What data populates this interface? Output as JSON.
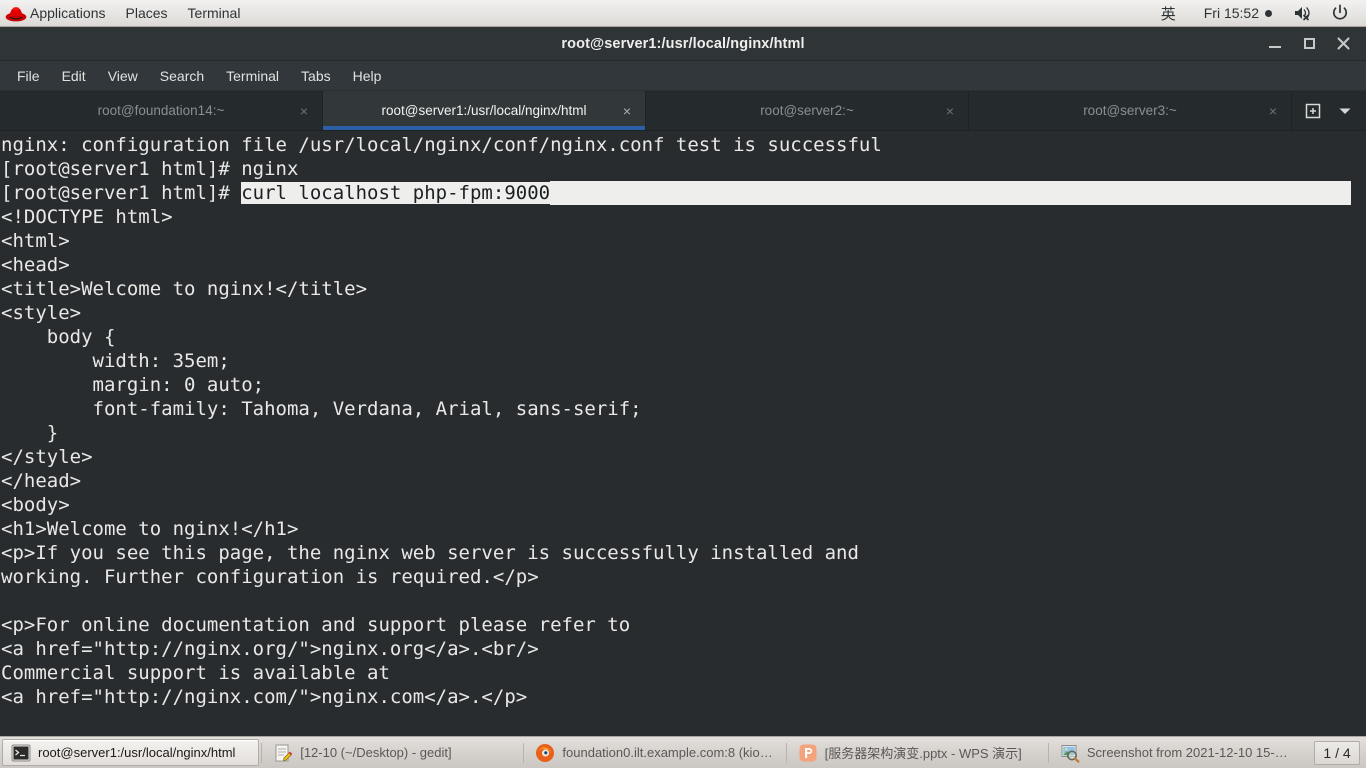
{
  "gnome_panel": {
    "logo_icon": "redhat-logo-icon",
    "menus": [
      "Applications",
      "Places",
      "Terminal"
    ],
    "input_method": "英",
    "clock": "Fri 15:52",
    "clock_dot": "●",
    "volume_icon": "speaker-muted-icon",
    "power_icon": "power-icon"
  },
  "window": {
    "title": "root@server1:/usr/local/nginx/html",
    "minimize_label": "Minimize",
    "maximize_label": "Maximize",
    "close_label": "Close"
  },
  "menubar": {
    "items": [
      "File",
      "Edit",
      "View",
      "Search",
      "Terminal",
      "Tabs",
      "Help"
    ]
  },
  "tabs": {
    "items": [
      {
        "label": "root@foundation14:~",
        "active": false,
        "close": "×"
      },
      {
        "label": "root@server1:/usr/local/nginx/html",
        "active": true,
        "close": "×"
      },
      {
        "label": "root@server2:~",
        "active": false,
        "close": "×"
      },
      {
        "label": "root@server3:~",
        "active": false,
        "close": "×"
      }
    ],
    "new_tab_icon": "new-tab-icon",
    "tab_list_icon": "chevron-down-icon"
  },
  "terminal": {
    "lines": [
      {
        "text": "nginx: configuration file /usr/local/nginx/conf/nginx.conf test is successful"
      },
      {
        "text": "[root@server1 html]# nginx"
      },
      {
        "prefix": "[root@server1 html]# ",
        "selected": "curl localhost php-fpm:9000",
        "selection_to_end": true
      },
      {
        "text": "<!DOCTYPE html>"
      },
      {
        "text": "<html>"
      },
      {
        "text": "<head>"
      },
      {
        "text": "<title>Welcome to nginx!</title>"
      },
      {
        "text": "<style>"
      },
      {
        "text": "    body {"
      },
      {
        "text": "        width: 35em;"
      },
      {
        "text": "        margin: 0 auto;"
      },
      {
        "text": "        font-family: Tahoma, Verdana, Arial, sans-serif;"
      },
      {
        "text": "    }"
      },
      {
        "text": "</style>"
      },
      {
        "text": "</head>"
      },
      {
        "text": "<body>"
      },
      {
        "text": "<h1>Welcome to nginx!</h1>"
      },
      {
        "text": "<p>If you see this page, the nginx web server is successfully installed and"
      },
      {
        "text": "working. Further configuration is required.</p>"
      },
      {
        "text": ""
      },
      {
        "text": "<p>For online documentation and support please refer to"
      },
      {
        "text": "<a href=\"http://nginx.org/\">nginx.org</a>.<br/>"
      },
      {
        "text": "Commercial support is available at"
      },
      {
        "text": "<a href=\"http://nginx.com/\">nginx.com</a>.</p>"
      }
    ]
  },
  "taskbar": {
    "items": [
      {
        "label": "root@server1:/usr/local/nginx/html",
        "icon": "terminal-icon",
        "active": true
      },
      {
        "label": "[12-10 (~/Desktop) - gedit]",
        "icon": "gedit-icon",
        "active": false
      },
      {
        "label": "foundation0.ilt.example.com:8 (kios…",
        "icon": "firefox-icon",
        "active": false
      },
      {
        "label": "[服务器架构演变.pptx - WPS 演示]",
        "icon": "wps-presentation-icon",
        "active": false
      },
      {
        "label": "Screenshot from 2021-12-10 15-…",
        "icon": "image-viewer-icon",
        "active": false
      }
    ],
    "workspace": "1 / 4"
  },
  "colors": {
    "terminal_bg": "#282c2f",
    "terminal_fg": "#e8e8e6",
    "selection_bg": "#eeeeec",
    "selection_fg": "#1c1f21",
    "tab_accent": "#2a5fa5",
    "panel_bg": "#e6e4e1",
    "taskbar_bg": "#d4d0cc"
  }
}
